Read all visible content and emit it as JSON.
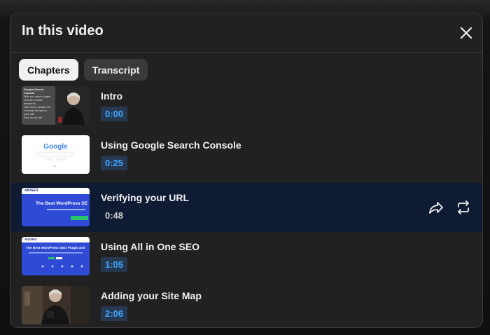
{
  "panel": {
    "title": "In this video",
    "close_icon": "close-icon"
  },
  "tabs": [
    {
      "label": "Chapters",
      "active": true
    },
    {
      "label": "Transcript",
      "active": false
    }
  ],
  "chapters": [
    {
      "title": "Intro",
      "time": "0:00",
      "thumb_text": [
        "Google Search Console",
        "Tells you which pages",
        "rank for certain",
        "keywords...",
        "How many people are",
        "clicking through to",
        "your site",
        "Easy to set up!"
      ]
    },
    {
      "title": "Using Google Search Console",
      "time": "0:25",
      "thumb_text": [
        "Google"
      ]
    },
    {
      "title": "Verifying your URL",
      "time": "0:48",
      "selected": true,
      "thumb_text": [
        "AIOSEO",
        "The Best WordPress SE"
      ],
      "actions": [
        "share-icon",
        "repeat-icon"
      ]
    },
    {
      "title": "Using All in One SEO",
      "time": "1:05",
      "thumb_text": [
        "AIOSEO",
        "The Best WordPress SEO Plugin and"
      ]
    },
    {
      "title": "Adding your Site Map",
      "time": "2:06",
      "thumb_text": []
    }
  ]
}
